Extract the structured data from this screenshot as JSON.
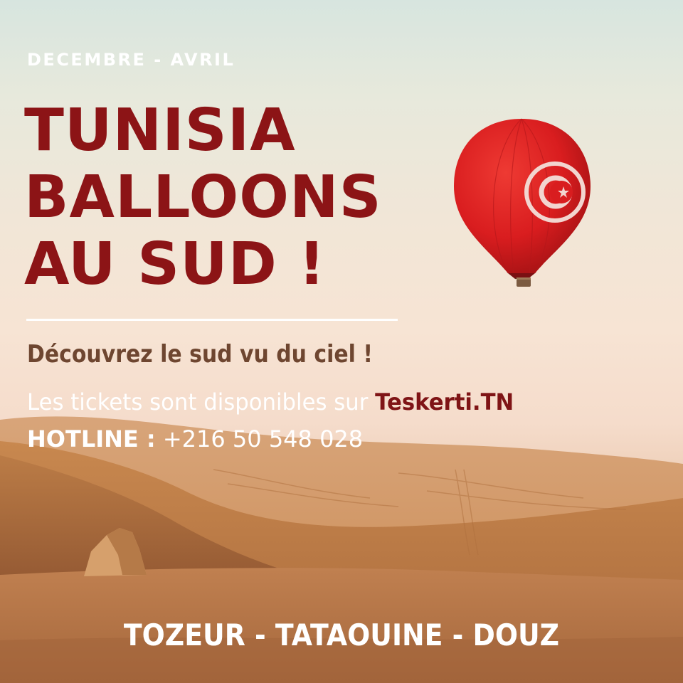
{
  "poster": {
    "season": "DECEMBRE - AVRIL",
    "title_lines": [
      "TUNISIA",
      "BALLOONS",
      "AU SUD !"
    ],
    "tagline": "Découvrez le sud vu du ciel !",
    "tickets_text": "Les tickets sont disponibles sur",
    "tickets_site": "Teskerti.TN",
    "hotline_label": "HOTLINE :",
    "hotline_number": "+216 50 548 028",
    "locations": "TOZEUR - TATAOUINE - DOUZ"
  },
  "colors": {
    "title": "#8c1416",
    "tagline": "#6e4630",
    "site": "#7f1416",
    "balloon": "#d91d1f",
    "sand": "#c9874f"
  },
  "icons": {
    "balloon_emblem": "tunisia-flag-crescent-star-icon"
  }
}
